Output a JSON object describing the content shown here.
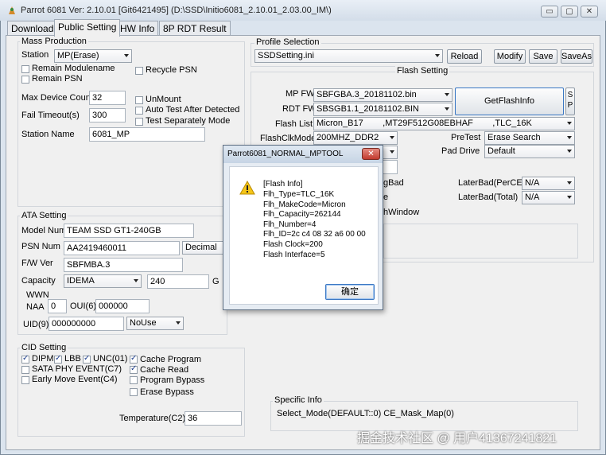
{
  "window": {
    "title": "Parrot 6081 Ver: 2.10.01 [Git6421495] (D:\\SSD\\Initio6081_2.10.01_2.03.00_IM\\)",
    "min_glyph": "▭",
    "max_glyph": "▢",
    "close_glyph": "✕"
  },
  "tabs": [
    "Download",
    "Public Setting",
    "HW Info",
    "8P RDT Result"
  ],
  "mass": {
    "group_label": "Mass Production",
    "station_label": "Station",
    "station_value": "MP(Erase)",
    "remain_modulename": "Remain Modulename",
    "remain_psn": "Remain PSN",
    "recycle_psn": "Recycle PSN",
    "max_device_label": "Max Device Count",
    "max_device_value": "32",
    "fail_timeout_label": "Fail Timeout(s)",
    "fail_timeout_value": "300",
    "unmount": "UnMount",
    "auto_test": "Auto Test After Detected",
    "test_sep": "Test Separately Mode",
    "station_name_label": "Station Name",
    "station_name_value": "6081_MP"
  },
  "ata": {
    "group_label": "ATA Setting",
    "model_label": "Model Num",
    "model_value": "TEAM SSD GT1-240GB",
    "psn_label": "PSN Num",
    "psn_value": "AA2419460011",
    "psn_format": "Decimal",
    "fw_label": "F/W Ver",
    "fw_value": "SBFMBA.3",
    "capacity_label": "Capacity",
    "capacity_mode": "IDEMA",
    "capacity_value": "240",
    "capacity_unit": "G",
    "wwn_label": "WWN",
    "naa_label": "NAA",
    "naa_value": "0",
    "oui_label": "OUI(6)",
    "oui_value": "000000",
    "uid_label": "UID(9)",
    "uid_value": "000000000",
    "uid_mode": "NoUse"
  },
  "cid": {
    "group_label": "CID Setting",
    "dipm": "DIPM",
    "lbb": "LBB",
    "unc": "UNC(01)",
    "sata_phy": "SATA PHY EVENT(C7)",
    "early_move": "Early Move Event(C4)",
    "cache_program": "Cache Program",
    "cache_read": "Cache Read",
    "program_bypass": "Program Bypass",
    "erase_bypass": "Erase Bypass",
    "temp_label": "Temperature(C2)",
    "temp_value": "36"
  },
  "profile": {
    "group_label": "Profile Selection",
    "file": "SSDSetting.ini",
    "reload": "Reload",
    "modify": "Modify",
    "save": "Save",
    "saveas": "SaveAs"
  },
  "flash": {
    "group_label": "Flash Setting",
    "mpfw_label": "MP FW",
    "mpfw_value": "SBFGBA.3_20181102.bin",
    "rdtfw_label": "RDT FW",
    "rdtfw_value": "SBSGB1.1_20181102.BIN",
    "getflash": "GetFlashInfo",
    "sp_top": "S",
    "sp_bottom": "P",
    "flashlist_label": "Flash List",
    "flashlist_value": "Micron_B17        ,MT29F512G08EBHAF        ,TLC_16K",
    "clkmode_label": "FlashClkMode",
    "clkmode_value": "200MHZ_DDR2",
    "pretest_label": "PreTest",
    "pretest_value": "Erase Search",
    "paddrive_label": "Pad Drive",
    "paddrive_value": "Default",
    "gbad_partial": "gBad",
    "e_partial": "e",
    "hwindow_partial": "hWindow",
    "laterbad_ce_label": "LaterBad(PerCE)",
    "laterbad_ce_value": "N/A",
    "laterbad_total_label": "LaterBad(Total)",
    "laterbad_total_value": "N/A"
  },
  "specific": {
    "group_label": "Specific Info",
    "text": "Select_Mode(DEFAULT::0) CE_Mask_Map(0)"
  },
  "dialog": {
    "title": "Parrot6081_NORMAL_MPTOOL",
    "close_glyph": "✕",
    "lines": [
      "[Flash Info]",
      "Flh_Type=TLC_16K",
      "Flh_MakeCode=Micron",
      "Flh_Capacity=262144",
      "Flh_Number=4",
      "Flh_ID=2c c4 08 32 a6 00 00",
      "Flash Clock=200",
      "Flash Interface=5"
    ],
    "ok": "确定",
    "icon": "warning-icon"
  },
  "watermark": "掘金技术社区 @ 用户41367241821",
  "colors": {
    "accent": "#3b78c4",
    "dialog_close": "#c8453a",
    "window_bg": "#dbe4ee"
  }
}
